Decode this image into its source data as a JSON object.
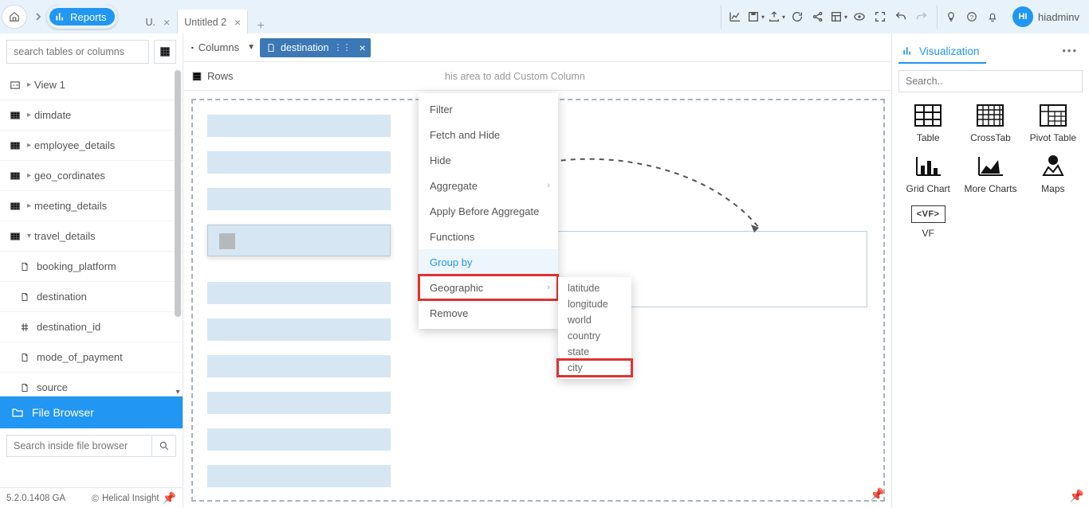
{
  "header": {
    "reports_label": "Reports",
    "tabs": [
      {
        "label": "U.",
        "active": false
      },
      {
        "label": "Untitled 2",
        "active": true
      }
    ],
    "user_initials": "HI",
    "username": "hiadminv"
  },
  "sidebar": {
    "search_placeholder": "search tables or columns",
    "items": [
      {
        "label": "View 1",
        "type": "view",
        "expandable": true
      },
      {
        "label": "dimdate",
        "type": "table",
        "expandable": true
      },
      {
        "label": "employee_details",
        "type": "table",
        "expandable": true
      },
      {
        "label": "geo_cordinates",
        "type": "table",
        "expandable": true
      },
      {
        "label": "meeting_details",
        "type": "table",
        "expandable": true
      },
      {
        "label": "travel_details",
        "type": "table",
        "expandable": true
      },
      {
        "label": "booking_platform",
        "type": "col-text",
        "child": true
      },
      {
        "label": "destination",
        "type": "col-text",
        "child": true
      },
      {
        "label": "destination_id",
        "type": "col-num",
        "child": true
      },
      {
        "label": "mode_of_payment",
        "type": "col-text",
        "child": true
      },
      {
        "label": "source",
        "type": "col-text",
        "child": true
      }
    ],
    "file_browser_label": "File Browser",
    "file_search_placeholder": "Search inside file browser",
    "version": "5.2.0.1408 GA",
    "copyright": "Helical Insight"
  },
  "shelf": {
    "columns_label": "Columns",
    "rows_label": "Rows",
    "chip_label": "destination",
    "rows_hint": "his area to add Custom Column"
  },
  "context_menu": {
    "items": [
      "Filter",
      "Fetch and Hide",
      "Hide",
      "Aggregate",
      "Apply Before Aggregate",
      "Functions",
      "Group by",
      "Geographic",
      "Remove"
    ],
    "submenu": [
      "latitude",
      "longitude",
      "world",
      "country",
      "state",
      "city"
    ]
  },
  "rightpanel": {
    "title": "Visualization",
    "search_placeholder": "Search..",
    "items": [
      "Table",
      "CrossTab",
      "Pivot Table",
      "Grid Chart",
      "More Charts",
      "Maps",
      "VF"
    ],
    "vf_tag": "<VF>"
  }
}
